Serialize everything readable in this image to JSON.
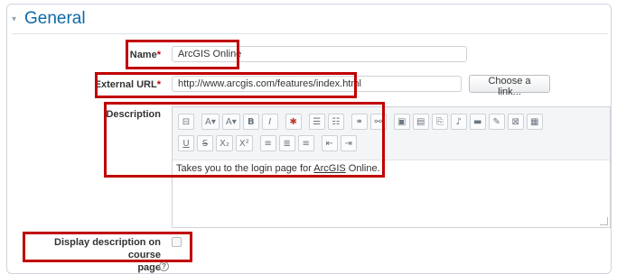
{
  "section": {
    "title": "General",
    "caret": "▾"
  },
  "fields": {
    "name": {
      "label": "Name",
      "required": "*",
      "value": "ArcGIS Online"
    },
    "external_url": {
      "label": "External URL",
      "required": "*",
      "value": "http://www.arcgis.com/features/index.html",
      "button": "Choose a link..."
    },
    "description": {
      "label": "Description",
      "text_before": "Takes you to the login page for ",
      "link_text": "ArcGIS",
      "text_after": " Online."
    },
    "display_description": {
      "label_line1": "Display description on course",
      "label_line2": "page",
      "checked": false
    }
  },
  "toolbar": {
    "row1": [
      "⊟",
      "A▾",
      "A▾",
      "B",
      "I",
      "✱",
      "☰",
      "☷",
      "⚭",
      "⚯",
      "▣",
      "▤",
      "⎘",
      "♪",
      "▬",
      "✎",
      "⊠",
      "▦"
    ],
    "row2": [
      "U",
      "S",
      "X₂",
      "X²",
      "≡",
      "≣",
      "≡",
      "⇤",
      "⇥"
    ]
  },
  "colors": {
    "accent": "#0f6aa7",
    "required": "#c10000",
    "highlight_box": "#c00000"
  },
  "icons": {
    "help": "?"
  }
}
